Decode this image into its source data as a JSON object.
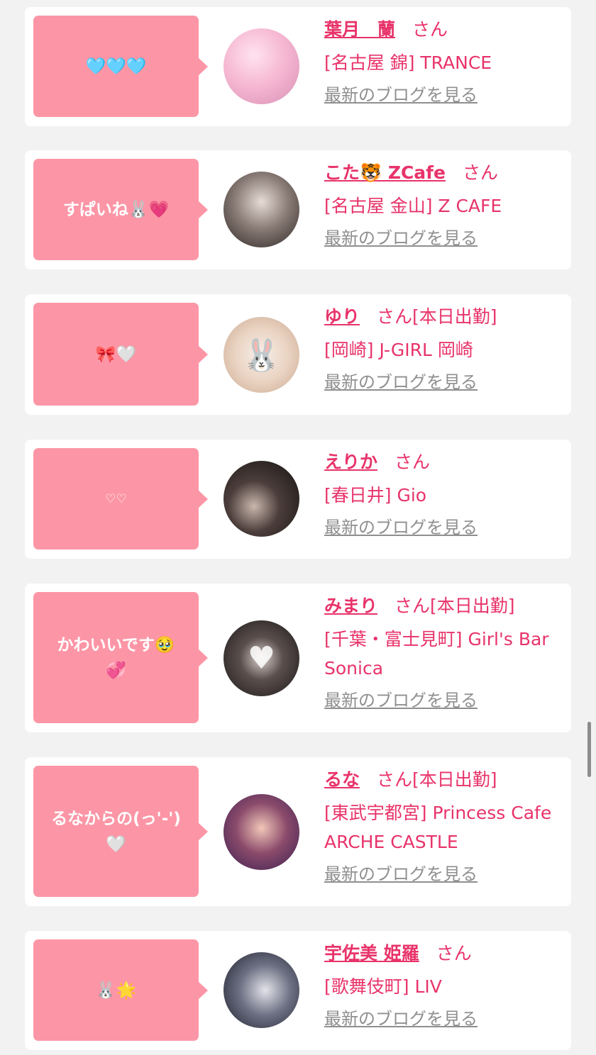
{
  "blog_link_label": "最新のブログを見る",
  "colors": {
    "background": "#f2f2f2",
    "bubble": "#fc96a6",
    "accent": "#e8336a",
    "link_gray": "#8f8f8f"
  },
  "entries": [
    {
      "message": "🩵🩵🩵",
      "name": "葉月　蘭",
      "suffix": "さん",
      "badge": "",
      "shop": "[名古屋 錦] TRANCE",
      "avatar_icon": "girl-photo-icon"
    },
    {
      "message": "すぱいね🐰💗",
      "name": "こた🐯 ZCafe",
      "suffix": "さん",
      "badge": "",
      "shop": "[名古屋 金山] Z CAFE",
      "avatar_icon": "girl-photo-icon"
    },
    {
      "message": "🎀🤍",
      "name": "ゆり",
      "suffix": "さん",
      "badge": "[本日出勤]",
      "shop": "[岡崎] J-GIRL 岡崎",
      "avatar_icon": "bunny-face-icon"
    },
    {
      "message": "♡♡",
      "name": "えりか",
      "suffix": "さん",
      "badge": "",
      "shop": "[春日井] Gio",
      "avatar_icon": "girl-photo-icon"
    },
    {
      "message": "かわいいです🥹\n💞",
      "name": "みまり",
      "suffix": "さん",
      "badge": "[本日出勤]",
      "shop": "[千葉・富士見町] Girl's Bar Sonica",
      "avatar_icon": "heart-icon"
    },
    {
      "message": "るなからの(っ'-')\n🤍",
      "name": "るな",
      "suffix": "さん",
      "badge": "[本日出勤]",
      "shop": "[東武宇都宮] Princess Cafe ARCHE CASTLE",
      "avatar_icon": "girl-photo-icon"
    },
    {
      "message": "🐰🌟",
      "name": "宇佐美 姫羅",
      "suffix": "さん",
      "badge": "",
      "shop": "[歌舞伎町] LIV",
      "avatar_icon": "girl-photo-icon"
    }
  ]
}
